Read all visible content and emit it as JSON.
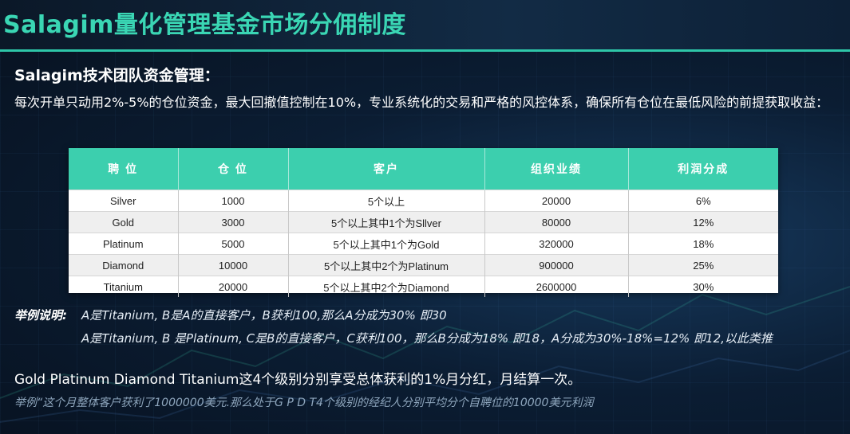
{
  "header": {
    "title": "Salagim量化管理基金市场分佣制度"
  },
  "intro": {
    "heading": "Salagim技术团队资金管理：",
    "text": "每次开单只动用2%-5%的仓位资金，最大回撤值控制在10%，专业系统化的交易和严格的风控体系，确保所有仓位在最低风险的前提获取收益："
  },
  "table": {
    "headers": [
      "聘 位",
      "仓 位",
      "客户",
      "组织业绩",
      "利润分成"
    ],
    "rows": [
      [
        "Silver",
        "1000",
        "5个以上",
        "20000",
        "6%"
      ],
      [
        "Gold",
        "3000",
        "5个以上其中1个为Sllver",
        "80000",
        "12%"
      ],
      [
        "Platinum",
        "5000",
        "5个以上其中1个为Gold",
        "320000",
        "18%"
      ],
      [
        "Diamond",
        "10000",
        "5个以上其中2个为Platinum",
        "900000",
        "25%"
      ],
      [
        "Titanium",
        "20000",
        "5个以上其中2个为Diamond",
        "2600000",
        "30%"
      ]
    ]
  },
  "example": {
    "label": "举例说明:",
    "line1": "A是Titanium, B是A的直接客户，B获利100,那么A分成为30% 即30",
    "line2": "A是Titanium, B 是Platinum, C是B的直接客户，C获利100，那么B分成为18% 即18，A分成为30%-18%=12% 即12,以此类推"
  },
  "bonus": {
    "text": "Gold Platinum Diamond Titanium这4个级别分别享受总体获利的1%月分红，月结算一次。",
    "example": "举例“这个月整体客户获利了1000000美元.那么处于G P D T4个级别的经纪人分别平均分个自聘位的10000美元利润"
  },
  "colors": {
    "accent": "#3ad6b4",
    "table_header": "#3ccfae",
    "background": "#0b1d33"
  }
}
